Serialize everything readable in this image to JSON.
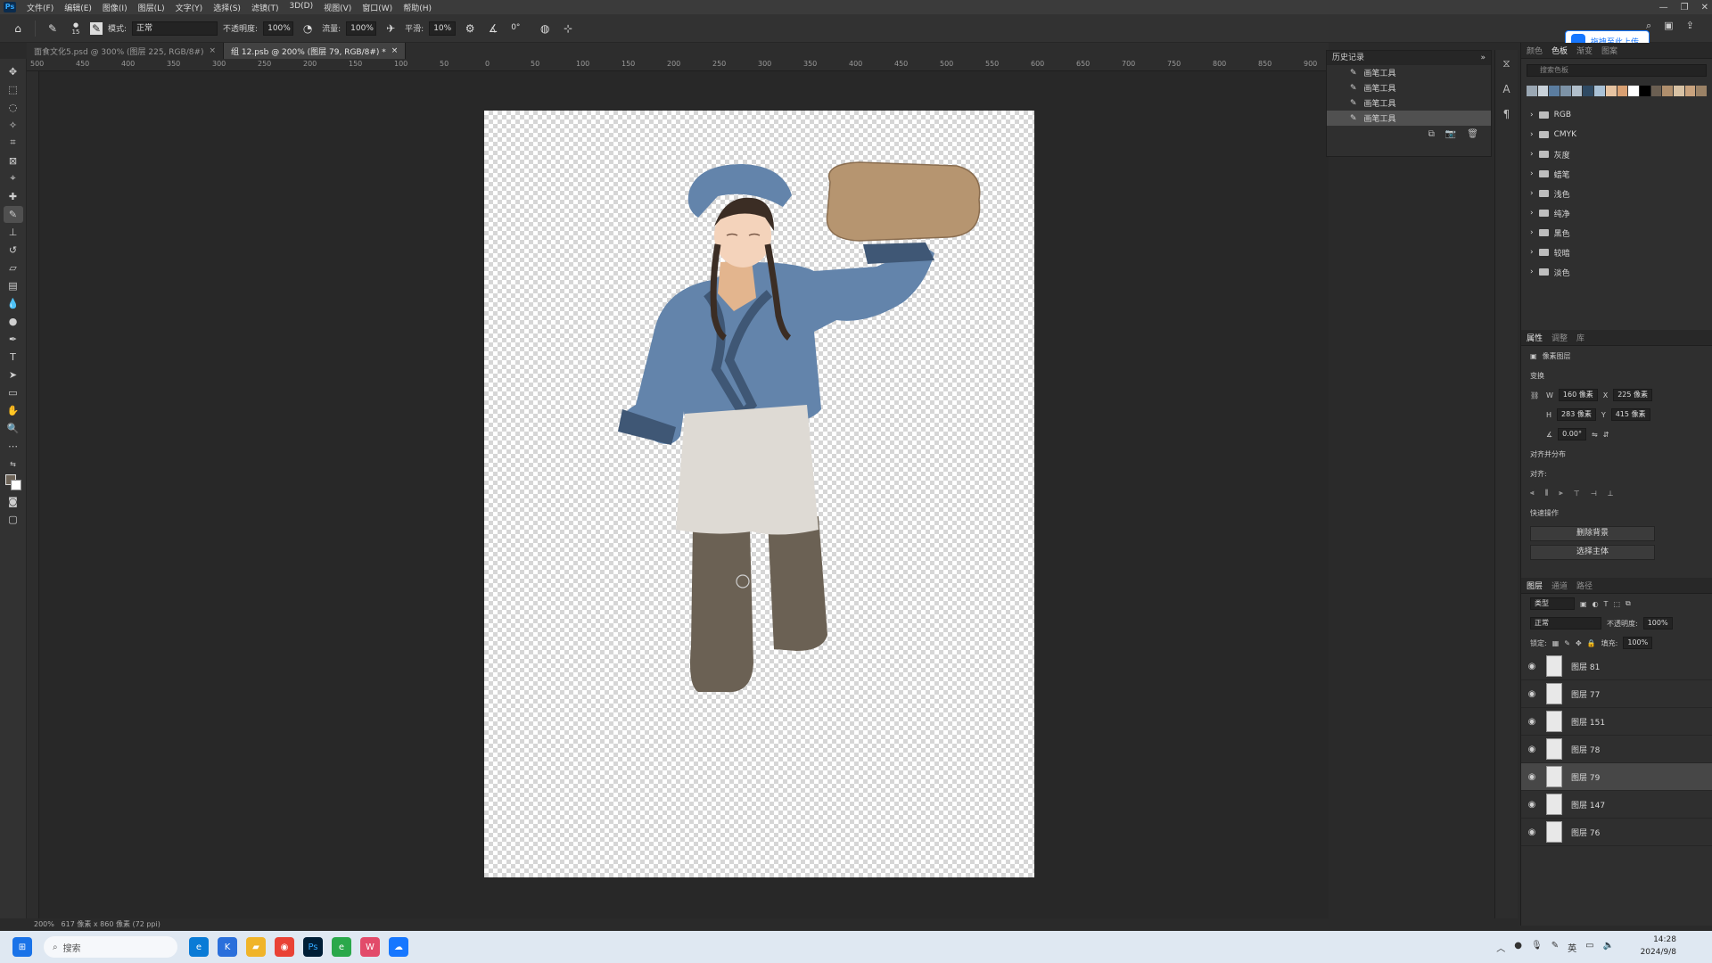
{
  "menus": [
    "文件(F)",
    "编辑(E)",
    "图像(I)",
    "图层(L)",
    "文字(Y)",
    "选择(S)",
    "滤镜(T)",
    "3D(D)",
    "视图(V)",
    "窗口(W)",
    "帮助(H)"
  ],
  "options": {
    "brush_size": "15",
    "mode_label": "模式:",
    "mode_value": "正常",
    "opacity_label": "不透明度:",
    "opacity_value": "100%",
    "flow_label": "流量:",
    "flow_value": "100%",
    "smooth_label": "平滑:",
    "smooth_value": "10%",
    "angle_value": "0°"
  },
  "upload": {
    "label": "拖拽至此上传"
  },
  "tabs": [
    {
      "label": "面食文化5.psd @ 300% (图层 225, RGB/8#)",
      "close": "×"
    },
    {
      "label": "组 12.psb @ 200% (图层 79, RGB/8#) *",
      "close": "×"
    }
  ],
  "ruler_h": [
    "500",
    "450",
    "400",
    "350",
    "300",
    "250",
    "200",
    "150",
    "100",
    "50",
    "0",
    "50",
    "100",
    "150",
    "200",
    "250",
    "300",
    "350",
    "400",
    "450",
    "500",
    "550",
    "600",
    "650",
    "700",
    "750",
    "800",
    "850",
    "900"
  ],
  "history": {
    "title": "历史记录",
    "items": [
      "画笔工具",
      "画笔工具",
      "画笔工具",
      "画笔工具"
    ]
  },
  "swatches": {
    "tabs": [
      "颜色",
      "色板",
      "渐变",
      "图案"
    ],
    "search_placeholder": "搜索色板",
    "colors": [
      "#9aa7b3",
      "#c9d2da",
      "#5b7da0",
      "#7d93a7",
      "#b1bfcb",
      "#2f4a63",
      "#a9c1d6",
      "#e6c3a1",
      "#d9a072",
      "#ffffff",
      "#000000",
      "#6b5f52",
      "#b08f6d",
      "#d8c2a4",
      "#c9a37e",
      "#9b8266"
    ],
    "groups": [
      "RGB",
      "CMYK",
      "灰度",
      "蜡笔",
      "浅色",
      "纯净",
      "黑色",
      "较暗",
      "淡色"
    ]
  },
  "properties": {
    "tabs": [
      "属性",
      "调整",
      "库"
    ],
    "type": "像素图层",
    "section_transform": "变换",
    "w": "160 像素",
    "h": "283 像素",
    "x": "225 像素",
    "y": "415 像素",
    "angle": "0.00°",
    "section_align": "对齐并分布",
    "align_label": "对齐:",
    "section_quick": "快速操作",
    "btn_remove_bg": "删除背景",
    "btn_select_subject": "选择主体"
  },
  "layers": {
    "tabs": [
      "图层",
      "通道",
      "路径"
    ],
    "filter": "类型",
    "blend": "正常",
    "opacity_label": "不透明度:",
    "opacity_value": "100%",
    "lock_label": "锁定:",
    "fill_label": "填充:",
    "fill_value": "100%",
    "items": [
      {
        "name": "图层 81",
        "selected": false
      },
      {
        "name": "图层 77",
        "selected": false
      },
      {
        "name": "图层 151",
        "selected": false
      },
      {
        "name": "图层 78",
        "selected": false
      },
      {
        "name": "图层 79",
        "selected": true
      },
      {
        "name": "图层 147",
        "selected": false
      },
      {
        "name": "图层 76",
        "selected": false
      }
    ]
  },
  "status": {
    "zoom": "200%",
    "doc": "617 像素 x 860 像素 (72 ppi)"
  },
  "taskbar": {
    "search": "搜索",
    "time": "14:28",
    "date": "2024/9/8"
  }
}
